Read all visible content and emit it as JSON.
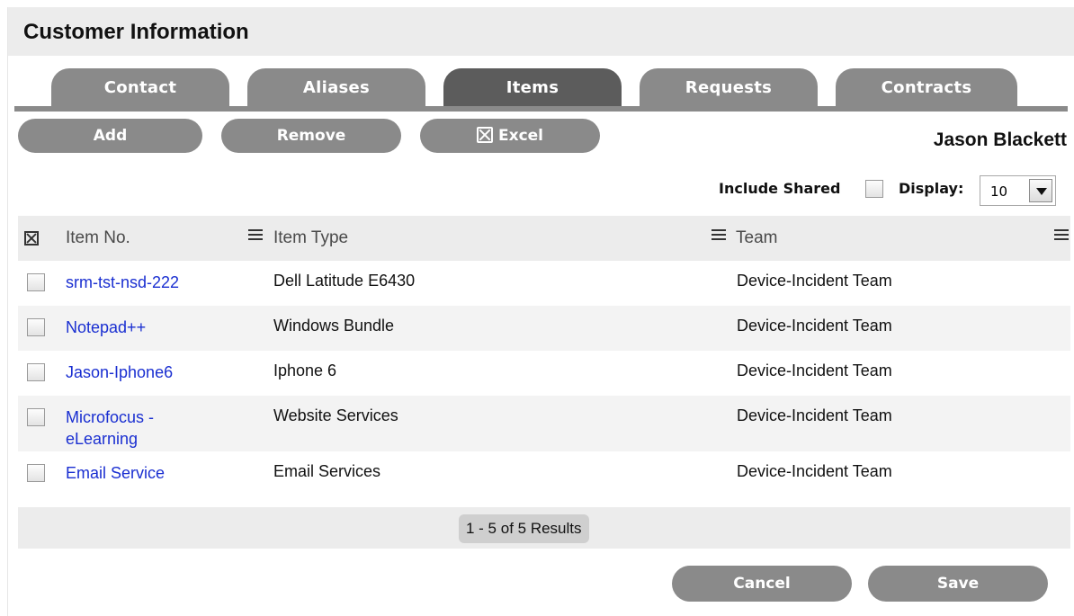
{
  "panel": {
    "title": "Customer Information"
  },
  "tabs": [
    {
      "label": "Contact",
      "active": false
    },
    {
      "label": "Aliases",
      "active": false
    },
    {
      "label": "Items",
      "active": true
    },
    {
      "label": "Requests",
      "active": false
    },
    {
      "label": "Contracts",
      "active": false
    }
  ],
  "toolbar": {
    "add_label": "Add",
    "remove_label": "Remove",
    "excel_label": "Excel",
    "excel_icon": "excel-export-icon"
  },
  "customer": {
    "name": "Jason Blackett"
  },
  "options": {
    "include_shared_label": "Include Shared",
    "include_shared_checked": false,
    "display_label": "Display:",
    "display_value": "10"
  },
  "table": {
    "columns": [
      {
        "label": "Item No."
      },
      {
        "label": "Item Type"
      },
      {
        "label": "Team"
      }
    ],
    "rows": [
      {
        "item_no": "srm-tst-nsd-222",
        "item_type": "Dell Latitude E6430",
        "team": "Device-Incident Team"
      },
      {
        "item_no": "Notepad++",
        "item_type": "Windows Bundle",
        "team": "Device-Incident Team"
      },
      {
        "item_no": "Jason-Iphone6",
        "item_type": "Iphone 6",
        "team": "Device-Incident Team"
      },
      {
        "item_no": "Microfocus - eLearning",
        "item_type": "Website Services",
        "team": "Device-Incident Team"
      },
      {
        "item_no": "Email Service",
        "item_type": "Email Services",
        "team": "Device-Incident Team"
      }
    ],
    "pager": "1 - 5 of 5 Results"
  },
  "footer": {
    "cancel_label": "Cancel",
    "save_label": "Save"
  },
  "colors": {
    "tab_inactive": "#8a8a8a",
    "tab_active": "#5c5c5c",
    "link": "#1a2fd1",
    "header_bg": "#ececec"
  }
}
